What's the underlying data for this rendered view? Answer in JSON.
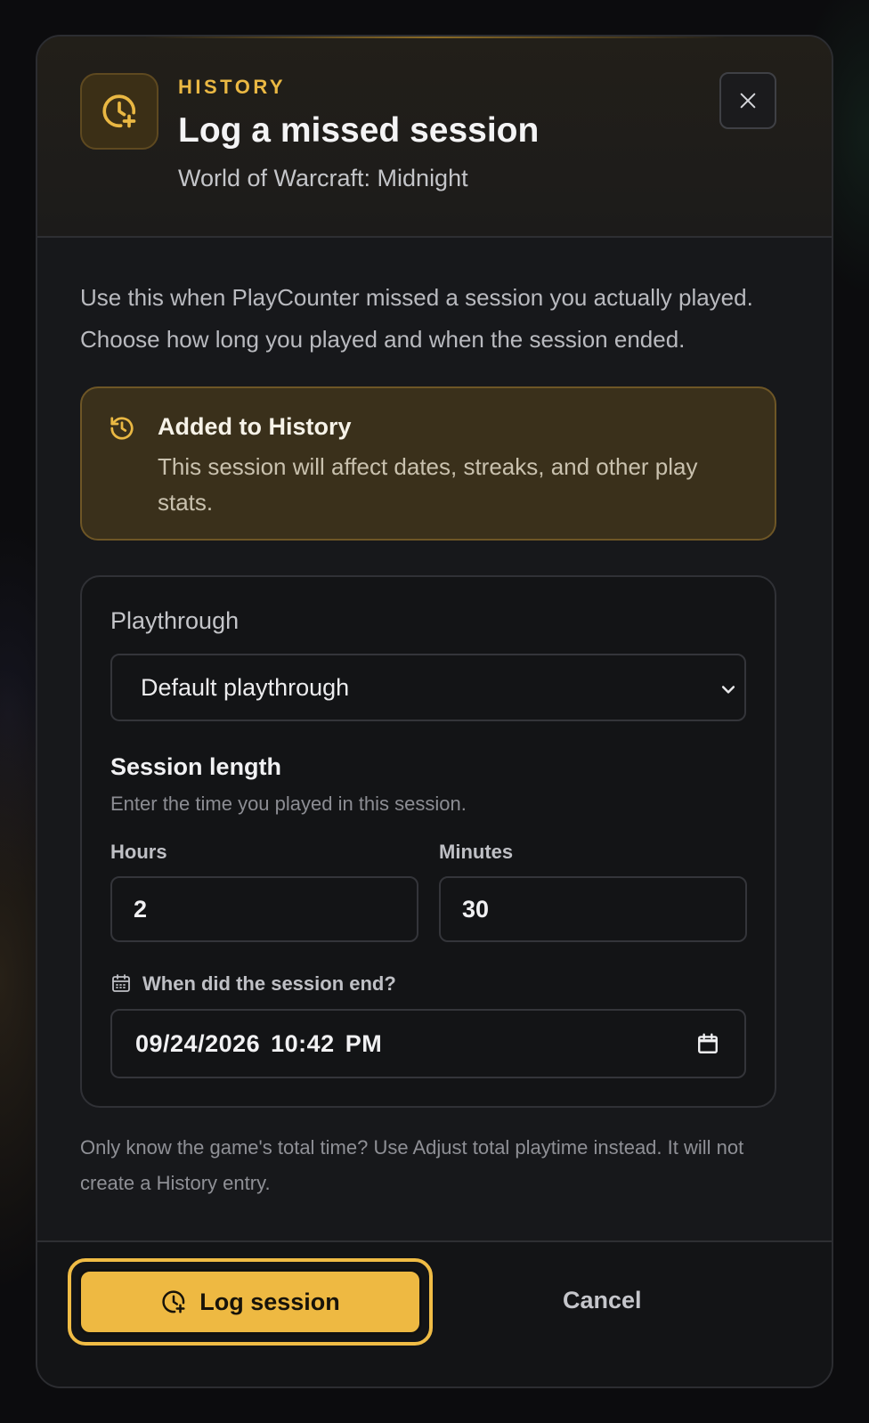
{
  "header": {
    "eyebrow": "HISTORY",
    "title": "Log a missed session",
    "subtitle": "World of Warcraft: Midnight",
    "icon": "clock-plus-icon",
    "close_icon": "close-icon"
  },
  "intro": "Use this when PlayCounter missed a session you actually played. Choose how long you played and when the session ended.",
  "notice": {
    "icon": "history-icon",
    "title": "Added to History",
    "text": "This session will affect dates, streaks, and other play stats."
  },
  "form": {
    "playthrough_label": "Playthrough",
    "playthrough_value": "Default playthrough",
    "session_title": "Session length",
    "session_hint": "Enter the time you played in this session.",
    "hours_label": "Hours",
    "hours_value": "2",
    "minutes_label": "Minutes",
    "minutes_value": "30",
    "end_label": "When did the session end?",
    "end_value": "09/24/2026 10:42 PM"
  },
  "footnote": "Only know the game's total time? Use Adjust total playtime instead. It will not create a History entry.",
  "footer": {
    "primary_label": "Log session",
    "cancel_label": "Cancel"
  },
  "colors": {
    "accent": "#eeb942",
    "notice_bg": "#3a301b",
    "modal_bg": "#17181b"
  }
}
